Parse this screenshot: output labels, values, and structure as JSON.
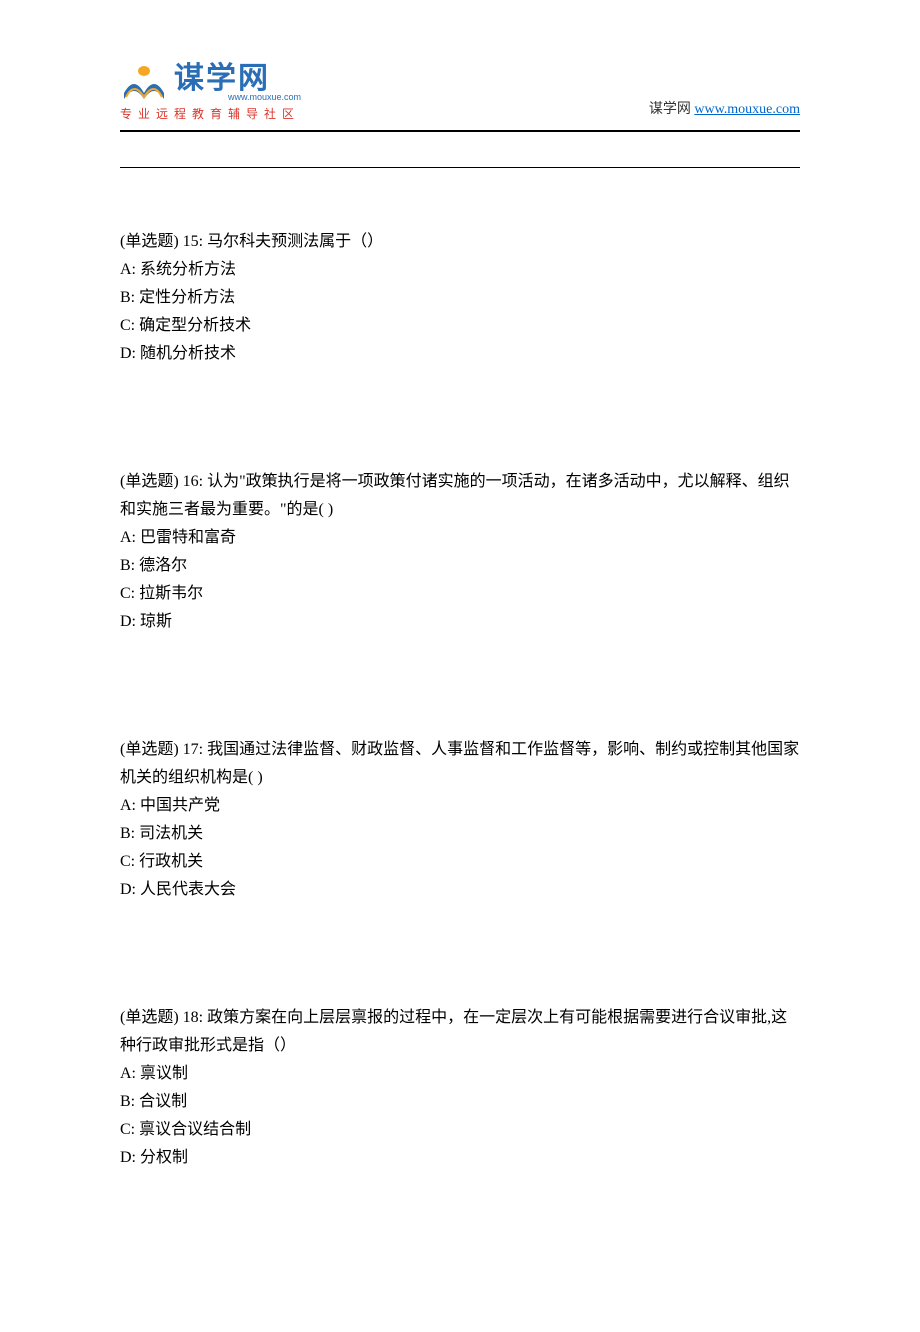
{
  "header": {
    "logo_text": "谋学网",
    "logo_url": "www.mouxue.com",
    "tagline": "专业远程教育辅导社区",
    "site_name": "谋学网",
    "site_link": "www.mouxue.com"
  },
  "questions": [
    {
      "type_label": "(单选题) 15:",
      "stem": " 马尔科夫预测法属于（）",
      "options": [
        "A: 系统分析方法",
        "B: 定性分析方法",
        "C: 确定型分析技术",
        "D: 随机分析技术"
      ]
    },
    {
      "type_label": "(单选题) 16:",
      "stem": " 认为\"政策执行是将一项政策付诸实施的一项活动，在诸多活动中，尤以解释、组织和实施三者最为重要。\"的是( )",
      "options": [
        "A: 巴雷特和富奇",
        "B: 德洛尔",
        "C: 拉斯韦尔",
        "D: 琼斯"
      ]
    },
    {
      "type_label": "(单选题) 17:",
      "stem": " 我国通过法律监督、财政监督、人事监督和工作监督等，影响、制约或控制其他国家机关的组织机构是( )",
      "options": [
        "A: 中国共产党",
        "B: 司法机关",
        "C: 行政机关",
        "D: 人民代表大会"
      ]
    },
    {
      "type_label": "(单选题) 18:",
      "stem": " 政策方案在向上层层禀报的过程中，在一定层次上有可能根据需要进行合议审批,这种行政审批形式是指（）",
      "options": [
        "A: 禀议制",
        "B: 合议制",
        "C: 禀议合议结合制",
        "D: 分权制"
      ]
    }
  ]
}
